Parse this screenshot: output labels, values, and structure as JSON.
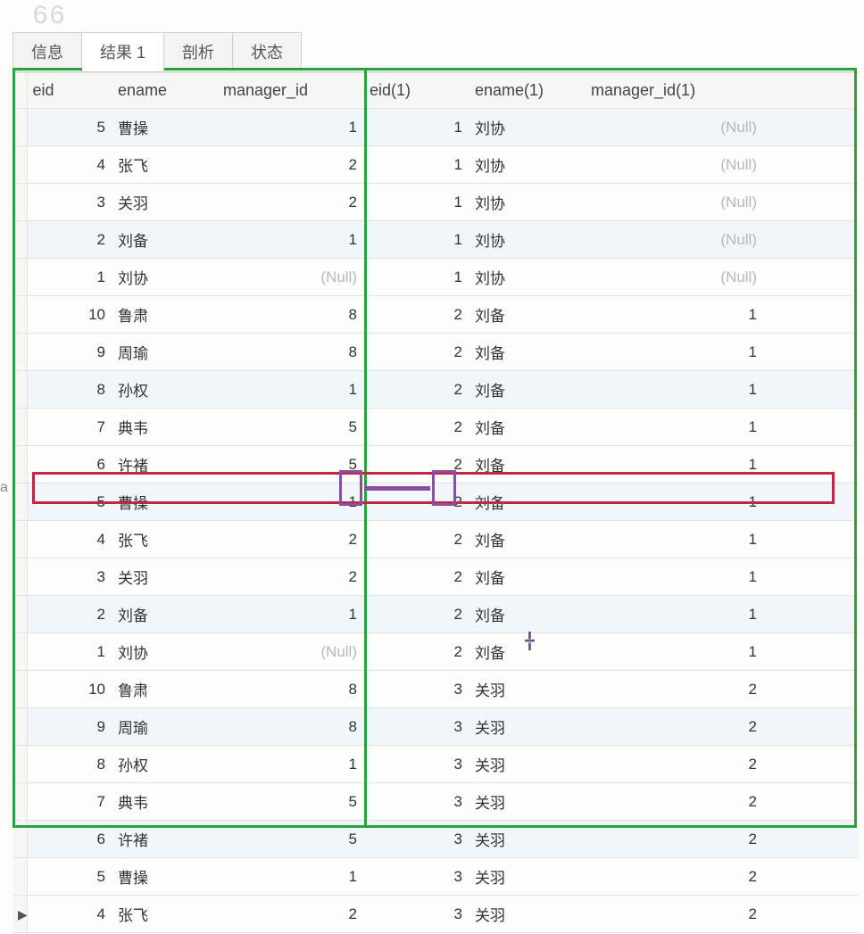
{
  "topnum": "66",
  "tabs": [
    {
      "label": "信息",
      "active": false
    },
    {
      "label": "结果 1",
      "active": true
    },
    {
      "label": "剖析",
      "active": false
    },
    {
      "label": "状态",
      "active": false
    }
  ],
  "columns": {
    "eid": "eid",
    "ename": "ename",
    "manager_id": "manager_id",
    "eid1": "eid(1)",
    "ename1": "ename(1)",
    "manager_id1": "manager_id(1)"
  },
  "rows": [
    {
      "eid": "5",
      "ename": "曹操",
      "mid": "1",
      "eid1": "1",
      "ename1": "刘协",
      "mid1": "(Null)",
      "mid1_null": true
    },
    {
      "eid": "4",
      "ename": "张飞",
      "mid": "2",
      "eid1": "1",
      "ename1": "刘协",
      "mid1": "(Null)",
      "mid1_null": true
    },
    {
      "eid": "3",
      "ename": "关羽",
      "mid": "2",
      "eid1": "1",
      "ename1": "刘协",
      "mid1": "(Null)",
      "mid1_null": true
    },
    {
      "eid": "2",
      "ename": "刘备",
      "mid": "1",
      "eid1": "1",
      "ename1": "刘协",
      "mid1": "(Null)",
      "mid1_null": true
    },
    {
      "eid": "1",
      "ename": "刘协",
      "mid": "(Null)",
      "mid_null": true,
      "eid1": "1",
      "ename1": "刘协",
      "mid1": "(Null)",
      "mid1_null": true
    },
    {
      "eid": "10",
      "ename": "鲁肃",
      "mid": "8",
      "eid1": "2",
      "ename1": "刘备",
      "mid1": "1"
    },
    {
      "eid": "9",
      "ename": "周瑜",
      "mid": "8",
      "eid1": "2",
      "ename1": "刘备",
      "mid1": "1"
    },
    {
      "eid": "8",
      "ename": "孙权",
      "mid": "1",
      "eid1": "2",
      "ename1": "刘备",
      "mid1": "1"
    },
    {
      "eid": "7",
      "ename": "典韦",
      "mid": "5",
      "eid1": "2",
      "ename1": "刘备",
      "mid1": "1"
    },
    {
      "eid": "6",
      "ename": "许褚",
      "mid": "5",
      "eid1": "2",
      "ename1": "刘备",
      "mid1": "1"
    },
    {
      "eid": "5",
      "ename": "曹操",
      "mid": "1",
      "eid1": "2",
      "ename1": "刘备",
      "mid1": "1"
    },
    {
      "eid": "4",
      "ename": "张飞",
      "mid": "2",
      "eid1": "2",
      "ename1": "刘备",
      "mid1": "1",
      "highlight": true
    },
    {
      "eid": "3",
      "ename": "关羽",
      "mid": "2",
      "eid1": "2",
      "ename1": "刘备",
      "mid1": "1"
    },
    {
      "eid": "2",
      "ename": "刘备",
      "mid": "1",
      "eid1": "2",
      "ename1": "刘备",
      "mid1": "1"
    },
    {
      "eid": "1",
      "ename": "刘协",
      "mid": "(Null)",
      "mid_null": true,
      "eid1": "2",
      "ename1": "刘备",
      "mid1": "1"
    },
    {
      "eid": "10",
      "ename": "鲁肃",
      "mid": "8",
      "eid1": "3",
      "ename1": "关羽",
      "mid1": "2"
    },
    {
      "eid": "9",
      "ename": "周瑜",
      "mid": "8",
      "eid1": "3",
      "ename1": "关羽",
      "mid1": "2"
    },
    {
      "eid": "8",
      "ename": "孙权",
      "mid": "1",
      "eid1": "3",
      "ename1": "关羽",
      "mid1": "2"
    },
    {
      "eid": "7",
      "ename": "典韦",
      "mid": "5",
      "eid1": "3",
      "ename1": "关羽",
      "mid1": "2"
    },
    {
      "eid": "6",
      "ename": "许褚",
      "mid": "5",
      "eid1": "3",
      "ename1": "关羽",
      "mid1": "2"
    },
    {
      "eid": "5",
      "ename": "曹操",
      "mid": "1",
      "eid1": "3",
      "ename1": "关羽",
      "mid1": "2"
    },
    {
      "eid": "4",
      "ename": "张飞",
      "mid": "2",
      "eid1": "3",
      "ename1": "关羽",
      "mid1": "2",
      "current": true
    }
  ],
  "left_fragment": "a"
}
